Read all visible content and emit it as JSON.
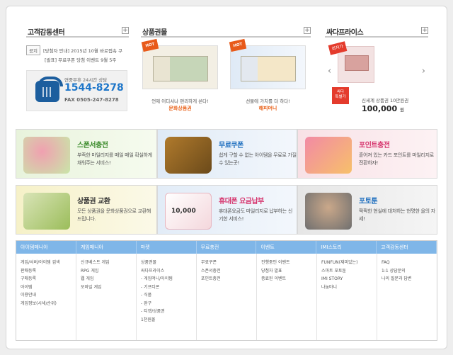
{
  "customer_center": {
    "title": "고객감동센터",
    "notice_badge": "공지",
    "notices": [
      "[당첨자 안내] 2015년 10월 바로접속 쿠",
      "[발표] 무료쿠폰 당첨 이벤트 9월 5주"
    ],
    "cs_label": "연중무휴 24시간 상담",
    "phone": "1544-8278",
    "fax": "FAX 0505-247-8278"
  },
  "gift_cards": {
    "title": "상품권몰",
    "items": [
      {
        "badge": "HOT",
        "desc": "언제 어디서나 편리하게 쓴다!",
        "name": "문화상품권"
      },
      {
        "badge": "HOT",
        "desc": "선물에 가치를 더 하다!",
        "name": "해피머니"
      }
    ]
  },
  "ssada_price": {
    "title": "싸다프라이스",
    "tag_top": "최저가",
    "tag_bottom_1": "싸다",
    "tag_bottom_2": "특별가",
    "note": "신세계 상품권 10만원권",
    "price": "100,000",
    "unit": "원"
  },
  "banners": [
    {
      "title": "스폰서충전",
      "desc": "부족한 마일리지를 매일 매일 확실하게 채워주는 서비스!",
      "color": "#3a8a2a"
    },
    {
      "title": "무료쿠폰",
      "desc": "쉽게 구할 수 없는 아이템을 무료로 가질수 있는곳!",
      "color": "#1f6fbf"
    },
    {
      "title": "포인트충전",
      "desc": "흩어져 있는 카드 포인트를 마일리지로 전환하자!",
      "color": "#d6336c"
    },
    {
      "title": "상품권 교환",
      "desc": "모든 상품권을 문화상품권으로 교환해드립니다.",
      "color": "#333333"
    },
    {
      "title": "휴대폰 요금납부",
      "desc": "휴대폰요금도 마일리지로 납부하는 신기한 서비스!",
      "color": "#d6336c",
      "art_text": "10,000"
    },
    {
      "title": "포토툰",
      "desc": "팍팍한 현실에 대처하는 현명한 을의 자세!",
      "color": "#1f6fbf"
    }
  ],
  "sitemap": {
    "headers": [
      "아이템매니아",
      "게임매니아",
      "마켓",
      "무료충전",
      "이벤트",
      "IMI스토리",
      "고객감동센터"
    ],
    "columns": [
      [
        "게임/서버/아이템 검색",
        "판매등록",
        "구매등록",
        "아이템",
        "이용안내",
        "게임정보(시세/순위)"
      ],
      [
        "신규베스트 게임",
        "RPG 게임",
        "웹 게임",
        "모바일 게임"
      ],
      [
        "상품권몰",
        "싸다프라이스",
        "- 게임머니/아이템",
        "- 기프티콘",
        "- 식품",
        "- 완구",
        "- 티켓/상품권",
        "1천원몰"
      ],
      [
        "무료쿠폰",
        "스폰서충전",
        "포인트충전"
      ],
      [
        "진행중인 이벤트",
        "당첨자 발표",
        "종료된 이벤트"
      ],
      [
        "FUNFUN(재미있는)",
        "스마트 포토툰",
        "IMI STORY",
        "나눔마니"
      ],
      [
        "FAQ",
        "1:1 상담문의",
        "나의 질문과 답변"
      ]
    ]
  }
}
